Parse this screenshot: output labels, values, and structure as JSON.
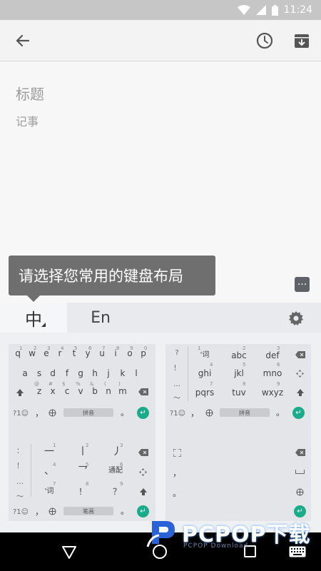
{
  "status": {
    "time": "11:24"
  },
  "note": {
    "title_placeholder": "标题",
    "body_placeholder": "记事"
  },
  "tooltip": {
    "text": "请选择您常用的键盘布局"
  },
  "keyboard": {
    "tab_zh": "中",
    "tab_en": "En",
    "qwerty": {
      "row1": [
        "q",
        "w",
        "e",
        "r",
        "t",
        "y",
        "u",
        "i",
        "o",
        "p"
      ],
      "row2": [
        "a",
        "s",
        "d",
        "f",
        "g",
        "h",
        "j",
        "k",
        "l"
      ],
      "row3": [
        "z",
        "x",
        "c",
        "v",
        "b",
        "n",
        "m"
      ],
      "row1_hints": [
        "1",
        "2",
        "3",
        "4",
        "5",
        "6",
        "7",
        "8",
        "9",
        "0"
      ],
      "row3_hints": [
        "@",
        "#",
        "$",
        "%",
        "&",
        "(",
        ")"
      ],
      "sym": "?1☺",
      "comma": "，",
      "period": "。",
      "space": "拼音"
    },
    "t9": {
      "keys": [
        "'词",
        "abc",
        "def",
        "ghi",
        "jkl",
        "mno",
        "pqrs",
        "tuv",
        "wxyz"
      ],
      "hints": [
        "1",
        "2",
        "3",
        "4",
        "5",
        "6",
        "7",
        "8",
        "9"
      ],
      "side": [
        "?",
        "！",
        "…",
        "～"
      ],
      "sym": "?1☺",
      "comma": "，",
      "period": "。",
      "space": "拼音"
    },
    "stroke": {
      "keys": [
        "一",
        "丨",
        "丿",
        "、",
        "乛",
        "通配",
        "'词",
        "！",
        "？"
      ],
      "hints": [
        "1",
        "2",
        "3",
        "4",
        "5",
        "6",
        "7",
        "8",
        "9"
      ],
      "side": [
        "：",
        "！",
        "…",
        "～"
      ],
      "sym": "?1☺",
      "comma": "，",
      "period": "。",
      "space": "笔画"
    },
    "handwriting": {
      "side": [
        "，",
        "。"
      ]
    }
  },
  "watermark": {
    "brand": "PCPOP下载",
    "sub": "PCPOP Download"
  },
  "colors": {
    "accent": "#1aab8a",
    "tooltip_bg": "#6f6f6f",
    "navbar": "#000000"
  }
}
